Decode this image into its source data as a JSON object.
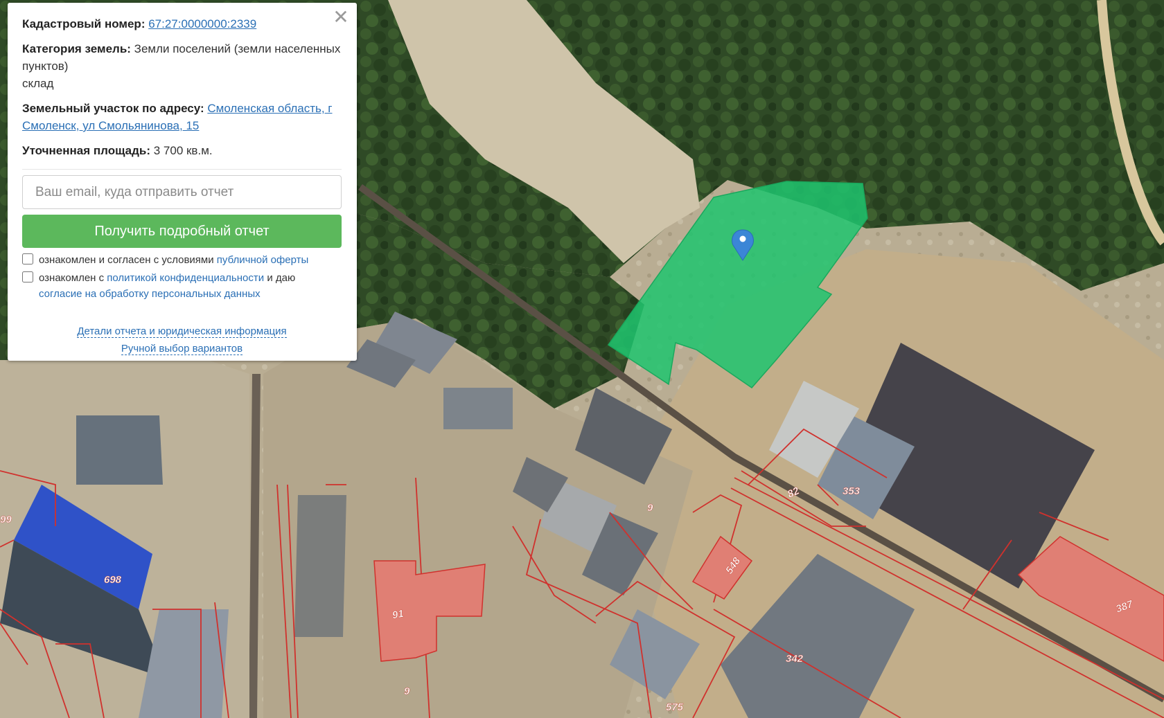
{
  "map": {
    "parcel_labels": [
      {
        "id": "p387",
        "text": "387"
      },
      {
        "id": "p698",
        "text": "698"
      },
      {
        "id": "p91",
        "text": "91"
      },
      {
        "id": "p548",
        "text": "548"
      },
      {
        "id": "p342",
        "text": "342"
      },
      {
        "id": "p353",
        "text": "353"
      },
      {
        "id": "p82",
        "text": "82"
      },
      {
        "id": "p575",
        "text": "575"
      },
      {
        "id": "p9a",
        "text": "9"
      },
      {
        "id": "p9b",
        "text": "9"
      },
      {
        "id": "p99",
        "text": "99"
      }
    ],
    "selected_parcel_color": "#1fc46e",
    "parcel_fill_color": "#e07f74",
    "parcel_border_color": "#d0312d"
  },
  "popup": {
    "cadastral_label": "Кадастровый номер:",
    "cadastral_number": "67:27:0000000:2339",
    "category_label": "Категория земель:",
    "category_value": "Земли поселений (земли населенных пунктов)",
    "category_use": "склад",
    "address_label": "Земельный участок по адресу:",
    "address_value": "Смоленская область, г Смоленск, ул Смольянинова, 15",
    "area_label": "Уточненная площадь:",
    "area_value": "3 700 кв.м.",
    "email_placeholder": "Ваш email, куда отправить отчет",
    "email_value": "",
    "submit_label": "Получить подробный отчет",
    "consent_offer_text": "ознакомлен и согласен с условиями",
    "consent_offer_link": "публичной оферты",
    "consent_privacy_text": "ознакомлен с",
    "consent_privacy_link": "политикой конфиденциальности",
    "consent_privacy_mid": "и даю",
    "consent_personal_link": "согласие на обработку персональных данных",
    "details_link": "Детали отчета и юридическая информация",
    "manual_link": "Ручной выбор вариантов",
    "close_icon": "close-icon"
  }
}
